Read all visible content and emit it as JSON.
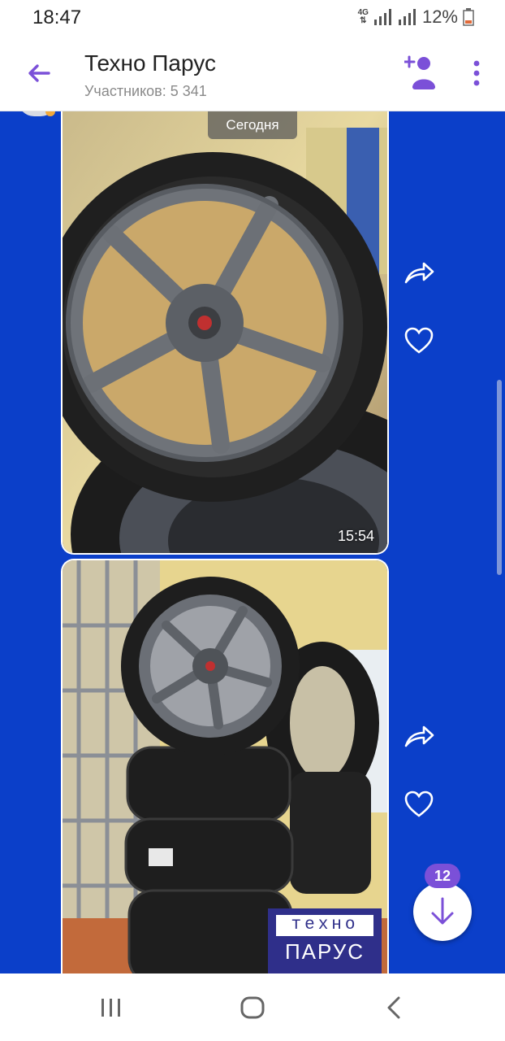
{
  "status": {
    "time": "18:47",
    "network": "4G",
    "battery": "12%"
  },
  "header": {
    "title": "Техно Парус",
    "subtitle": "Участников: 5 341"
  },
  "chat": {
    "date_separator": "Сегодня",
    "messages": [
      {
        "time": "15:54",
        "type": "photo"
      },
      {
        "type": "photo",
        "watermark_top": "техно",
        "watermark_bottom": "ПАРУС"
      }
    ]
  },
  "scroll_fab": {
    "unread_count": "12"
  },
  "icons": [
    "back-arrow-icon",
    "add-member-icon",
    "more-vert-icon",
    "share-icon",
    "heart-icon",
    "arrow-down-icon",
    "recent-apps-icon",
    "home-icon",
    "back-nav-icon"
  ],
  "colors": {
    "accent": "#7b50d8",
    "chat_background": "#0b3fc9"
  }
}
